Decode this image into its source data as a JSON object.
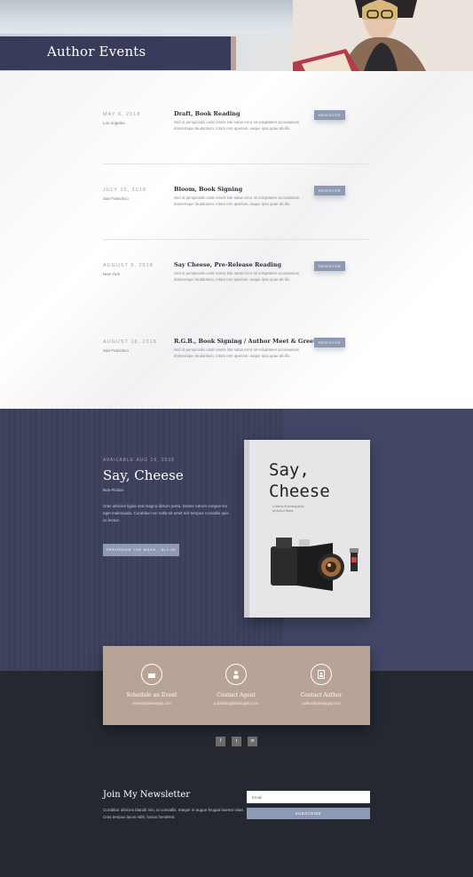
{
  "hero": {
    "title": "Author Events"
  },
  "events": [
    {
      "date": "MAY 6, 2018",
      "location": "Los Angeles",
      "name": "Draft, Book Reading",
      "description": "Sed ut perspiciatis unde omnis iste natus error sit voluptatem accusantium doloremque laudantium, totam rem aperiam, eaque ipsa quae ab illo.",
      "button": "REGISTER"
    },
    {
      "date": "JULY 15, 2018",
      "location": "San Francisco",
      "name": "Bloom, Book Signing",
      "description": "Sed ut perspiciatis unde omnis iste natus error sit voluptatem accusantium doloremque laudantium, totam rem aperiam, eaque ipsa quae ab illo.",
      "button": "REGISTER"
    },
    {
      "date": "AUGUST 5, 2018",
      "location": "New York",
      "name": "Say Cheese, Pre-Release Reading",
      "description": "Sed ut perspiciatis unde omnis iste natus error sit voluptatem accusantium doloremque laudantium, totam rem aperiam, eaque ipsa quae ab illo.",
      "button": "REGISTER"
    },
    {
      "date": "AUGUST 18, 2018",
      "location": "San Francisco",
      "name": "R.G.B., Book Signing / Author Meet & Greet",
      "description": "Sed ut perspiciatis unde omnis iste natus error sit voluptatem accusantium doloremque laudantium, totam rem aperiam, eaque ipsa quae ab illo.",
      "button": "REGISTER"
    }
  ],
  "book": {
    "available": "AVAILABLE AUG 16, 2018",
    "title": "Say, Cheese",
    "genre": "Non-Fiction",
    "description": "Cras ultricies ligula sed magna dictum porta. Donec rutrum congue leo eget malesuada. Curabitur non nulla sit amet nisl tempus convallis quis ac lectus.",
    "button": "PREORDER THE BOOK - $12.95",
    "cover_title_line1": "Say,",
    "cover_title_line2": "Cheese",
    "cover_subtitle_line1": "a history of photography",
    "cover_subtitle_line2": "by Author Name"
  },
  "contact": [
    {
      "icon": "calendar-icon",
      "title": "Schedule an Event",
      "info": "events@divisupply.com"
    },
    {
      "icon": "person-icon",
      "title": "Contact Agent",
      "info": "publishing@divisupply.com"
    },
    {
      "icon": "contact-card-icon",
      "title": "Contact Author",
      "info": "author@divisupply.com"
    }
  ],
  "social": [
    {
      "icon": "facebook-icon",
      "glyph": "f"
    },
    {
      "icon": "twitter-icon",
      "glyph": "t"
    },
    {
      "icon": "linkedin-icon",
      "glyph": "in"
    }
  ],
  "newsletter": {
    "title": "Join My Newsletter",
    "description": "Curabitur ultricies blandit nisi, ut convallis. Integer in augue feugiat laoreet vitae. Cras tempus lacus nibh, luctus hendrerit.",
    "email_placeholder": "Email",
    "button": "SUBSCRIBE"
  },
  "colors": {
    "navy": "#383b5a",
    "tan": "#b8a496",
    "button": "#8e9ab3",
    "dark": "#252830"
  }
}
